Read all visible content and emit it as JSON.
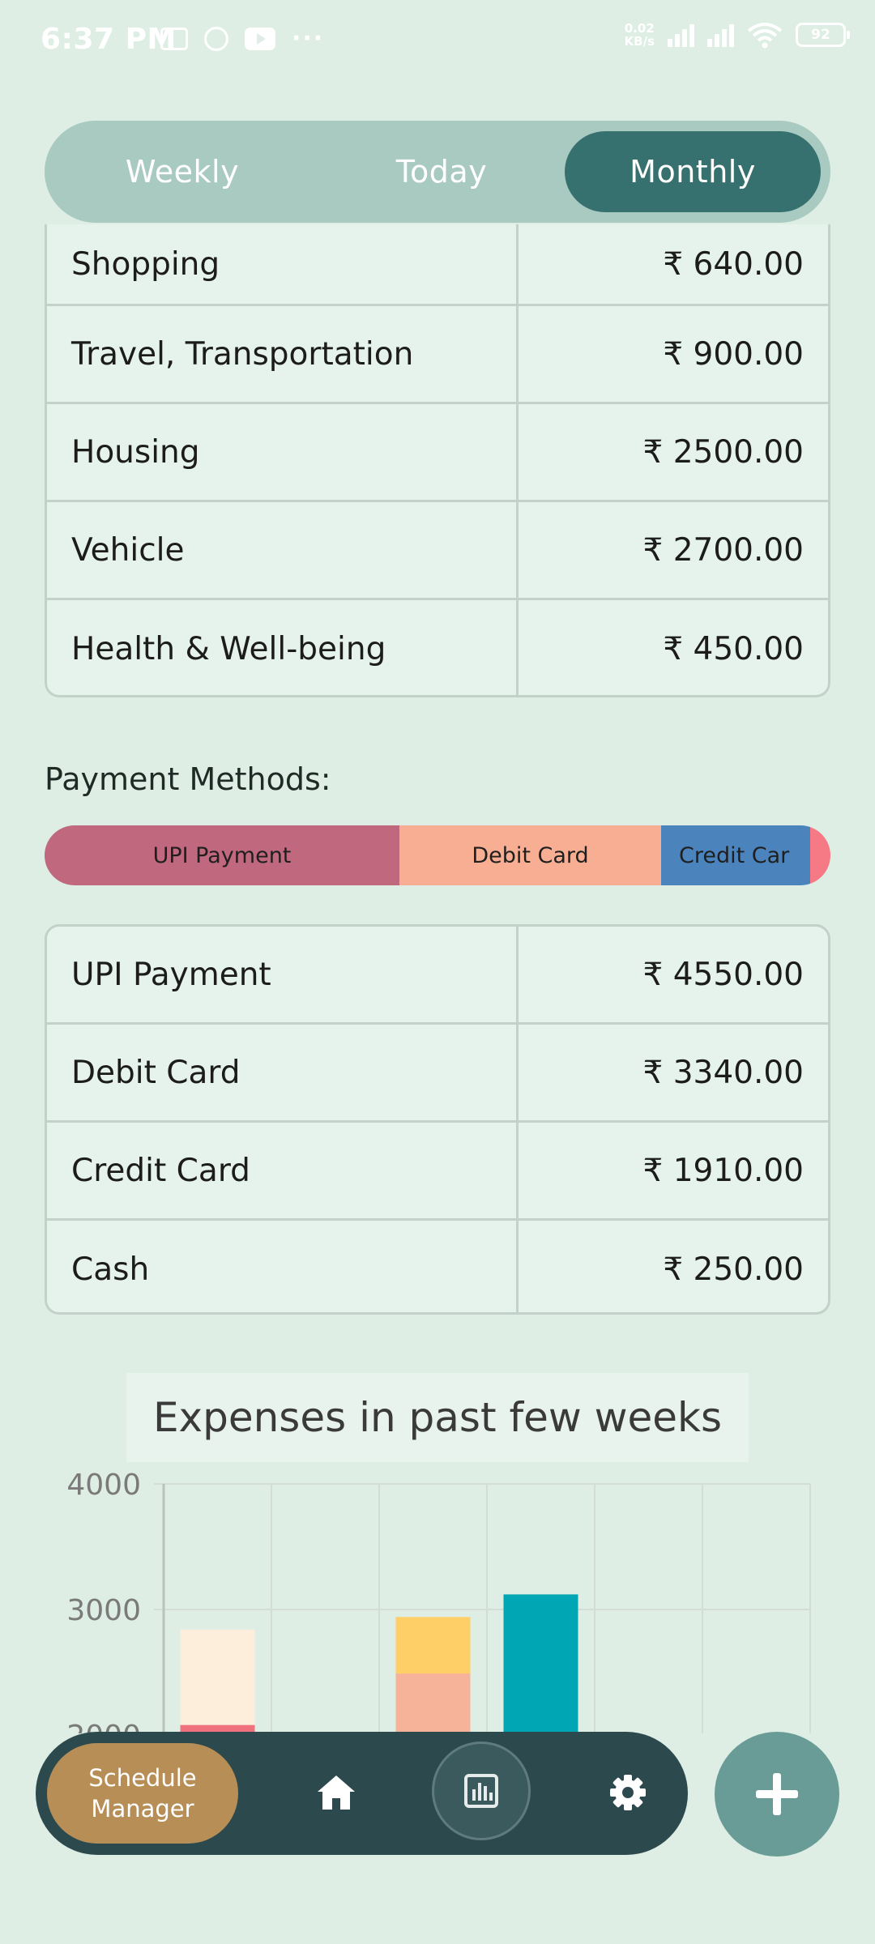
{
  "status_bar": {
    "time": "6:37 PM",
    "net_speed_value": "0.02",
    "net_speed_unit": "KB/s",
    "battery": "92",
    "more": "···"
  },
  "period_toggle": {
    "options": [
      "Weekly",
      "Today",
      "Monthly"
    ],
    "selected": "Monthly"
  },
  "category_table": {
    "rows": [
      {
        "label": "Shopping",
        "amount": "₹ 640.00"
      },
      {
        "label": "Travel, Transportation",
        "amount": "₹ 900.00"
      },
      {
        "label": "Housing",
        "amount": "₹ 2500.00"
      },
      {
        "label": "Vehicle",
        "amount": "₹ 2700.00"
      },
      {
        "label": "Health & Well-being",
        "amount": "₹ 450.00"
      }
    ]
  },
  "payment_methods": {
    "title": "Payment Methods:",
    "bar_segments": [
      {
        "label": "UPI Payment",
        "value": 4550,
        "color": "#c0687e"
      },
      {
        "label": "Debit Card",
        "value": 3340,
        "color": "#f7ae93"
      },
      {
        "label": "Credit Car",
        "value": 1910,
        "color": "#4b84bd"
      },
      {
        "label": "",
        "value": 250,
        "color": "#f57a86"
      }
    ],
    "rows": [
      {
        "label": "UPI Payment",
        "amount": "₹ 4550.00"
      },
      {
        "label": "Debit Card",
        "amount": "₹ 3340.00"
      },
      {
        "label": "Credit Card",
        "amount": "₹ 1910.00"
      },
      {
        "label": "Cash",
        "amount": "₹ 250.00"
      }
    ]
  },
  "chart_data": {
    "type": "bar",
    "stacked": true,
    "title": "Expenses in past few weeks",
    "y_ticks": [
      "4000",
      "3000",
      "2000"
    ],
    "ylim_visible": [
      2000,
      4000
    ],
    "grid": true,
    "bar_stacks": [
      {
        "segments": [
          {
            "from": 1900,
            "to": 2080,
            "color": "#f0707e"
          },
          {
            "from": 2080,
            "to": 2840,
            "color": "#fdeedb"
          }
        ]
      },
      {
        "segments": []
      },
      {
        "segments": [
          {
            "from": 1900,
            "to": 2490,
            "color": "#f7b29a"
          },
          {
            "from": 2490,
            "to": 2940,
            "color": "#fdcf66"
          }
        ]
      },
      {
        "segments": [
          {
            "from": 1900,
            "to": 3120,
            "color": "#00a6b3"
          }
        ]
      },
      {
        "segments": []
      },
      {
        "segments": []
      }
    ]
  },
  "bottom_nav": {
    "schedule_label": "Schedule\nManager",
    "items": [
      "home-icon",
      "bar-chart-icon",
      "gear-icon"
    ],
    "fab_icon": "plus-icon"
  }
}
